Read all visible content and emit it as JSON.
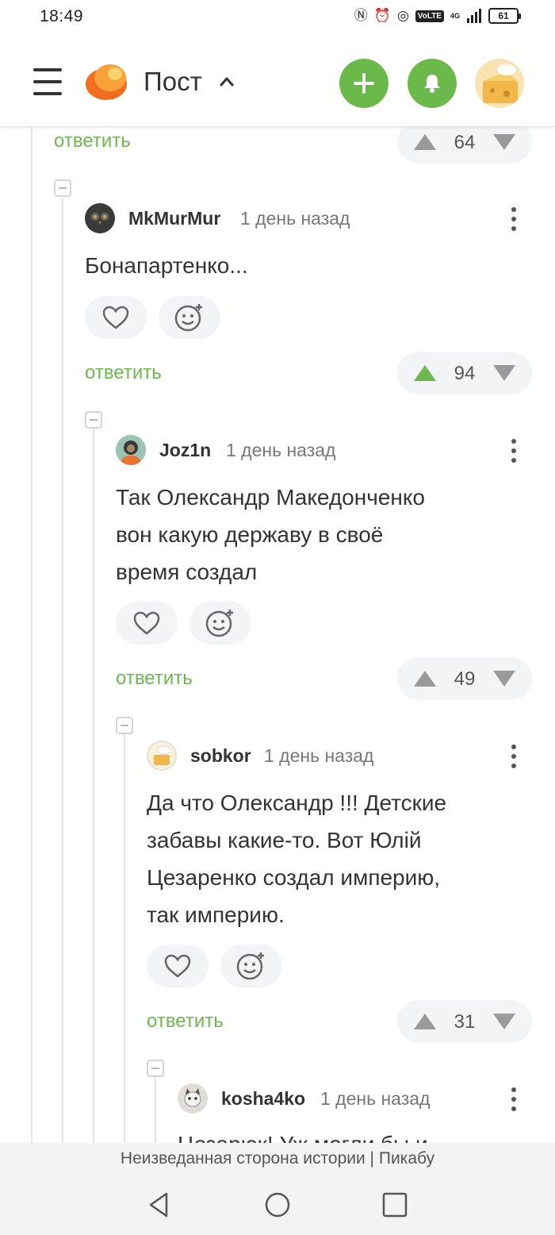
{
  "status_bar": {
    "time": "18:49",
    "battery": "61",
    "network": "4G",
    "volte": "VoLTE"
  },
  "header": {
    "title": "Пост"
  },
  "colors": {
    "accent": "#6cb94b",
    "vote_bg": "#f3f4f6"
  },
  "thread": {
    "top": {
      "reply_label": "ответить",
      "rating": "64"
    },
    "comments": [
      {
        "username": "MkMurMur",
        "time": "1 день назад",
        "text": "Бонапартенко...",
        "reply_label": "ответить",
        "rating": "94",
        "upvoted": true,
        "avatar_icon": "owl-avatar-icon"
      },
      {
        "username": "Joz1n",
        "time": "1 день назад",
        "text_lines": [
          "Так Олександр Македонченко",
          "вон какую державу в своё",
          "время создал"
        ],
        "reply_label": "ответить",
        "rating": "49",
        "upvoted": false,
        "avatar_icon": "astronaut-avatar-icon"
      },
      {
        "username": "sobkor",
        "time": "1 день назад",
        "text_lines": [
          "Да что Олександр !!! Детские",
          "забавы какие-то. Вот Юлій",
          "Цезаренко создал империю,",
          "так империю."
        ],
        "reply_label": "ответить",
        "rating": "31",
        "upvoted": false,
        "avatar_icon": "cheese-avatar-icon"
      },
      {
        "username": "kosha4ko",
        "time": "1 день назад",
        "text_partial": "Цезарюк! Уж могли бы и",
        "avatar_icon": "cat-avatar-icon"
      }
    ]
  },
  "footer": {
    "page_title": "Неизведанная сторона истории | Пикабу"
  }
}
